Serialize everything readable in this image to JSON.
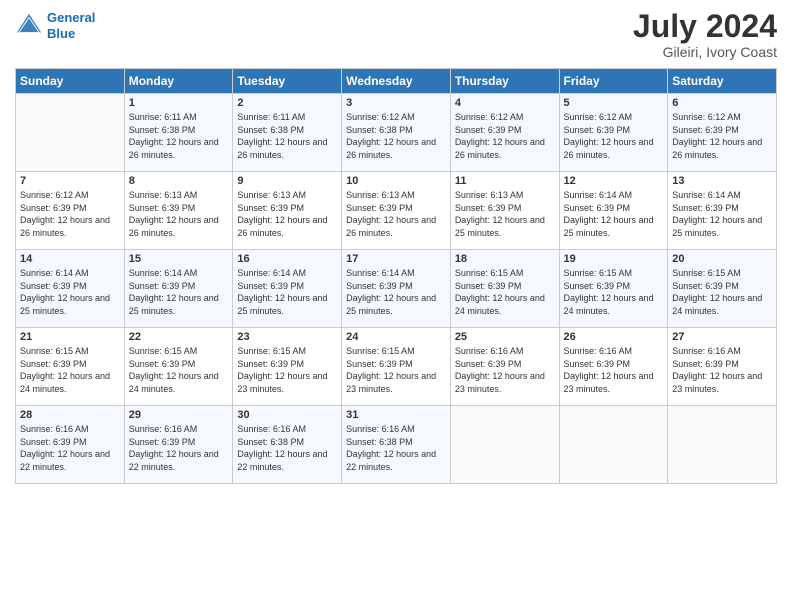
{
  "header": {
    "logo_line1": "General",
    "logo_line2": "Blue",
    "month_year": "July 2024",
    "location": "Gileiri, Ivory Coast"
  },
  "days_of_week": [
    "Sunday",
    "Monday",
    "Tuesday",
    "Wednesday",
    "Thursday",
    "Friday",
    "Saturday"
  ],
  "weeks": [
    [
      {
        "day": "",
        "sunrise": "",
        "sunset": "",
        "daylight": ""
      },
      {
        "day": "1",
        "sunrise": "Sunrise: 6:11 AM",
        "sunset": "Sunset: 6:38 PM",
        "daylight": "Daylight: 12 hours and 26 minutes."
      },
      {
        "day": "2",
        "sunrise": "Sunrise: 6:11 AM",
        "sunset": "Sunset: 6:38 PM",
        "daylight": "Daylight: 12 hours and 26 minutes."
      },
      {
        "day": "3",
        "sunrise": "Sunrise: 6:12 AM",
        "sunset": "Sunset: 6:38 PM",
        "daylight": "Daylight: 12 hours and 26 minutes."
      },
      {
        "day": "4",
        "sunrise": "Sunrise: 6:12 AM",
        "sunset": "Sunset: 6:39 PM",
        "daylight": "Daylight: 12 hours and 26 minutes."
      },
      {
        "day": "5",
        "sunrise": "Sunrise: 6:12 AM",
        "sunset": "Sunset: 6:39 PM",
        "daylight": "Daylight: 12 hours and 26 minutes."
      },
      {
        "day": "6",
        "sunrise": "Sunrise: 6:12 AM",
        "sunset": "Sunset: 6:39 PM",
        "daylight": "Daylight: 12 hours and 26 minutes."
      }
    ],
    [
      {
        "day": "7",
        "sunrise": "Sunrise: 6:12 AM",
        "sunset": "Sunset: 6:39 PM",
        "daylight": "Daylight: 12 hours and 26 minutes."
      },
      {
        "day": "8",
        "sunrise": "Sunrise: 6:13 AM",
        "sunset": "Sunset: 6:39 PM",
        "daylight": "Daylight: 12 hours and 26 minutes."
      },
      {
        "day": "9",
        "sunrise": "Sunrise: 6:13 AM",
        "sunset": "Sunset: 6:39 PM",
        "daylight": "Daylight: 12 hours and 26 minutes."
      },
      {
        "day": "10",
        "sunrise": "Sunrise: 6:13 AM",
        "sunset": "Sunset: 6:39 PM",
        "daylight": "Daylight: 12 hours and 26 minutes."
      },
      {
        "day": "11",
        "sunrise": "Sunrise: 6:13 AM",
        "sunset": "Sunset: 6:39 PM",
        "daylight": "Daylight: 12 hours and 25 minutes."
      },
      {
        "day": "12",
        "sunrise": "Sunrise: 6:14 AM",
        "sunset": "Sunset: 6:39 PM",
        "daylight": "Daylight: 12 hours and 25 minutes."
      },
      {
        "day": "13",
        "sunrise": "Sunrise: 6:14 AM",
        "sunset": "Sunset: 6:39 PM",
        "daylight": "Daylight: 12 hours and 25 minutes."
      }
    ],
    [
      {
        "day": "14",
        "sunrise": "Sunrise: 6:14 AM",
        "sunset": "Sunset: 6:39 PM",
        "daylight": "Daylight: 12 hours and 25 minutes."
      },
      {
        "day": "15",
        "sunrise": "Sunrise: 6:14 AM",
        "sunset": "Sunset: 6:39 PM",
        "daylight": "Daylight: 12 hours and 25 minutes."
      },
      {
        "day": "16",
        "sunrise": "Sunrise: 6:14 AM",
        "sunset": "Sunset: 6:39 PM",
        "daylight": "Daylight: 12 hours and 25 minutes."
      },
      {
        "day": "17",
        "sunrise": "Sunrise: 6:14 AM",
        "sunset": "Sunset: 6:39 PM",
        "daylight": "Daylight: 12 hours and 25 minutes."
      },
      {
        "day": "18",
        "sunrise": "Sunrise: 6:15 AM",
        "sunset": "Sunset: 6:39 PM",
        "daylight": "Daylight: 12 hours and 24 minutes."
      },
      {
        "day": "19",
        "sunrise": "Sunrise: 6:15 AM",
        "sunset": "Sunset: 6:39 PM",
        "daylight": "Daylight: 12 hours and 24 minutes."
      },
      {
        "day": "20",
        "sunrise": "Sunrise: 6:15 AM",
        "sunset": "Sunset: 6:39 PM",
        "daylight": "Daylight: 12 hours and 24 minutes."
      }
    ],
    [
      {
        "day": "21",
        "sunrise": "Sunrise: 6:15 AM",
        "sunset": "Sunset: 6:39 PM",
        "daylight": "Daylight: 12 hours and 24 minutes."
      },
      {
        "day": "22",
        "sunrise": "Sunrise: 6:15 AM",
        "sunset": "Sunset: 6:39 PM",
        "daylight": "Daylight: 12 hours and 24 minutes."
      },
      {
        "day": "23",
        "sunrise": "Sunrise: 6:15 AM",
        "sunset": "Sunset: 6:39 PM",
        "daylight": "Daylight: 12 hours and 23 minutes."
      },
      {
        "day": "24",
        "sunrise": "Sunrise: 6:15 AM",
        "sunset": "Sunset: 6:39 PM",
        "daylight": "Daylight: 12 hours and 23 minutes."
      },
      {
        "day": "25",
        "sunrise": "Sunrise: 6:16 AM",
        "sunset": "Sunset: 6:39 PM",
        "daylight": "Daylight: 12 hours and 23 minutes."
      },
      {
        "day": "26",
        "sunrise": "Sunrise: 6:16 AM",
        "sunset": "Sunset: 6:39 PM",
        "daylight": "Daylight: 12 hours and 23 minutes."
      },
      {
        "day": "27",
        "sunrise": "Sunrise: 6:16 AM",
        "sunset": "Sunset: 6:39 PM",
        "daylight": "Daylight: 12 hours and 23 minutes."
      }
    ],
    [
      {
        "day": "28",
        "sunrise": "Sunrise: 6:16 AM",
        "sunset": "Sunset: 6:39 PM",
        "daylight": "Daylight: 12 hours and 22 minutes."
      },
      {
        "day": "29",
        "sunrise": "Sunrise: 6:16 AM",
        "sunset": "Sunset: 6:39 PM",
        "daylight": "Daylight: 12 hours and 22 minutes."
      },
      {
        "day": "30",
        "sunrise": "Sunrise: 6:16 AM",
        "sunset": "Sunset: 6:38 PM",
        "daylight": "Daylight: 12 hours and 22 minutes."
      },
      {
        "day": "31",
        "sunrise": "Sunrise: 6:16 AM",
        "sunset": "Sunset: 6:38 PM",
        "daylight": "Daylight: 12 hours and 22 minutes."
      },
      {
        "day": "",
        "sunrise": "",
        "sunset": "",
        "daylight": ""
      },
      {
        "day": "",
        "sunrise": "",
        "sunset": "",
        "daylight": ""
      },
      {
        "day": "",
        "sunrise": "",
        "sunset": "",
        "daylight": ""
      }
    ]
  ]
}
